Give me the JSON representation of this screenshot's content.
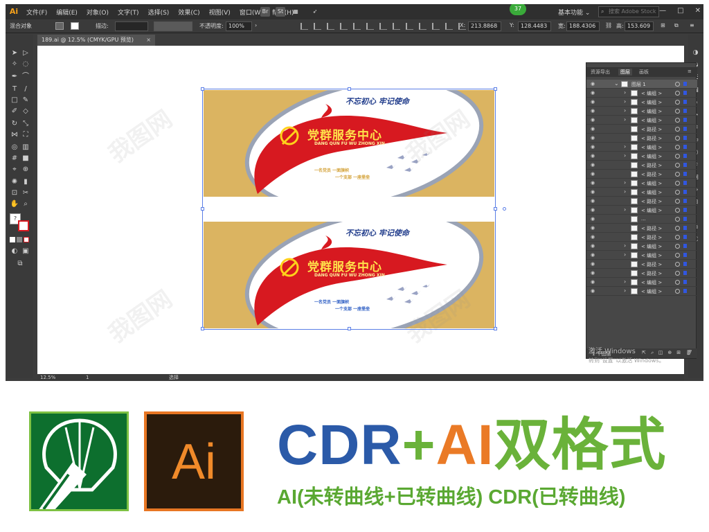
{
  "menubar": {
    "logo": "Ai",
    "menus": [
      "文件(F)",
      "编辑(E)",
      "对象(O)",
      "文字(T)",
      "选择(S)",
      "效果(C)",
      "视图(V)",
      "窗口(W)",
      "帮助(H)"
    ],
    "br_label": "Br",
    "st_label": "St",
    "badge": "37",
    "workspace": "基本功能",
    "stock_search_placeholder": "搜索 Adobe Stock",
    "minimize": "—",
    "restore": "□",
    "close": "✕"
  },
  "controlbar": {
    "label_mixed": "混合对象",
    "stroke_label": "描边:",
    "opacity_label": "不透明度:",
    "opacity_value": "100%",
    "x_label": "X:",
    "x_value": "213.8868",
    "y_label": "Y:",
    "y_value": "128.4483",
    "w_label": "宽:",
    "w_value": "188.4306",
    "h_label": "高:",
    "h_value": "153.609"
  },
  "document": {
    "tab_title": "189.ai @ 12.5% (CMYK/GPU 预览)",
    "close_glyph": "×"
  },
  "statusbar": {
    "zoom": "12.5%",
    "page": "1",
    "tool": "选择"
  },
  "artwork": {
    "slogan": "不忘初心 牢记使命",
    "title": "党群服务中心",
    "pinyin": "DANG QUN FU WU ZHONG XIN",
    "line1": "一名党员 一面旗帜",
    "line2": "一个支部 一座堡垒"
  },
  "layers": {
    "tabs": [
      "资源导出",
      "图层",
      "画板"
    ],
    "active_tab": "图层",
    "rows": [
      {
        "name": "图层 1",
        "top": true
      },
      {
        "name": "< 编组 >",
        "caret": true
      },
      {
        "name": "< 编组 >",
        "caret": true
      },
      {
        "name": "< 编组 >",
        "caret": true
      },
      {
        "name": "< 编组 >",
        "caret": true
      },
      {
        "name": "< 路径 >"
      },
      {
        "name": "< 路径 >"
      },
      {
        "name": "< 编组 >",
        "caret": true
      },
      {
        "name": "< 编组 >",
        "caret": true
      },
      {
        "name": "< 路径 >"
      },
      {
        "name": "< 路径 >"
      },
      {
        "name": "< 编组 >",
        "caret": true
      },
      {
        "name": "< 编组 >",
        "caret": true
      },
      {
        "name": "< 路径 >"
      },
      {
        "name": "< 编组 >",
        "caret": true
      },
      {
        "name": "..."
      },
      {
        "name": "< 路径 >"
      },
      {
        "name": "< 路径 >"
      },
      {
        "name": "< 编组 >",
        "caret": true
      },
      {
        "name": "< 编组 >",
        "caret": true
      },
      {
        "name": "< 路径 >"
      },
      {
        "name": "< 路径 >"
      },
      {
        "name": "< 编组 >",
        "caret": true
      },
      {
        "name": "< 编组 >",
        "caret": true
      }
    ],
    "footer_label": "1 个图层"
  },
  "activation": {
    "line1": "激活 Windows",
    "line2": "转到\"设置\"以激活 Windows。"
  },
  "promo": {
    "cdr": "CDR",
    "plus": "+",
    "ai": "AI",
    "format": "双格式",
    "subline": "AI(未转曲线+已转曲线) CDR(已转曲线)",
    "ai_logo_text": "Ai"
  },
  "colors": {
    "panel_gold": "#dbb461",
    "party_red": "#d71920",
    "cdr_blue": "#2b5aa8",
    "ai_orange": "#ea7a26",
    "green": "#6ab23a"
  }
}
